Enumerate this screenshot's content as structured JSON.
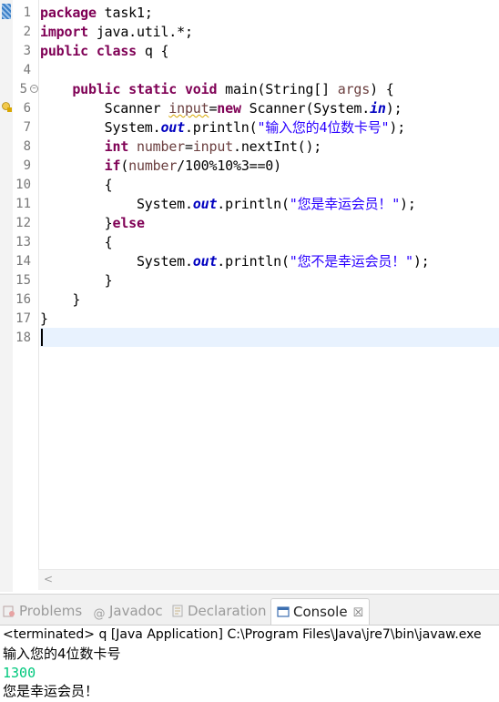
{
  "editor": {
    "line_numbers": [
      "1",
      "2",
      "3",
      "4",
      "5",
      "6",
      "7",
      "8",
      "9",
      "10",
      "11",
      "12",
      "13",
      "14",
      "15",
      "16",
      "17",
      "18"
    ],
    "code": {
      "l1_kw": "package",
      "l1_rest": " task1;",
      "l2_kw": "import",
      "l2_rest": " java.util.*;",
      "l3_kw1": "public",
      "l3_kw2": "class",
      "l3_rest": " q {",
      "l5_indent": "    ",
      "l5_kw": "public static void",
      "l5_rest": " main(String[] ",
      "l5_var": "args",
      "l5_end": ") {",
      "l6_a": "        Scanner ",
      "l6_var": "input",
      "l6_eq": "=",
      "l6_kw": "new",
      "l6_b": " Scanner(System.",
      "l6_fld": "in",
      "l6_end": ");",
      "l7_a": "        System.",
      "l7_fld": "out",
      "l7_b": ".println(",
      "l7_str": "\"输入您的4位数卡号\"",
      "l7_end": ");",
      "l8_indent": "        ",
      "l8_kw": "int",
      "l8_sp": " ",
      "l8_var1": "number",
      "l8_eq": "=",
      "l8_var2": "input",
      "l8_end": ".nextInt();",
      "l9_indent": "        ",
      "l9_kw": "if",
      "l9_open": "(",
      "l9_var": "number",
      "l9_end": "/100%10%3==0)",
      "l10": "        {",
      "l11_a": "            System.",
      "l11_fld": "out",
      "l11_b": ".println(",
      "l11_str": "\"您是幸运会员！\"",
      "l11_end": ");",
      "l12_a": "        }",
      "l12_kw": "else",
      "l13": "        {",
      "l14_a": "            System.",
      "l14_fld": "out",
      "l14_b": ".println(",
      "l14_str": "\"您不是幸运会员！\"",
      "l14_end": ");",
      "l15": "        }",
      "l16": "    }",
      "l17": "}"
    }
  },
  "tabs": {
    "problems": "Problems",
    "javadoc": "Javadoc",
    "declaration": "Declaration",
    "console": "Console"
  },
  "console": {
    "status": "<terminated> q [Java Application] C:\\Program Files\\Java\\jre7\\bin\\javaw.exe",
    "line1": "输入您的4位数卡号",
    "line2": "1300",
    "line3": "您是幸运会员！"
  },
  "colors": {
    "keyword": "#7f0055",
    "string": "#2a00ff",
    "field": "#0000c0",
    "local_var": "#6a3e3e",
    "console_input": "#00c87d",
    "current_line": "#e8f2fe"
  }
}
